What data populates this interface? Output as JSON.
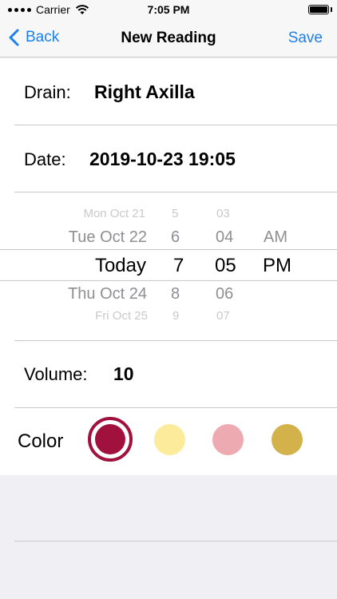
{
  "status_bar": {
    "carrier": "Carrier",
    "time": "7:05 PM",
    "wifi_icon": "wifi-icon",
    "battery_icon": "battery-icon"
  },
  "nav": {
    "back_label": "Back",
    "title": "New Reading",
    "save_label": "Save",
    "back_icon": "chevron-left-icon"
  },
  "form": {
    "drain": {
      "label": "Drain:",
      "value": "Right Axilla"
    },
    "date": {
      "label": "Date:",
      "value": "2019-10-23 19:05"
    },
    "volume": {
      "label": "Volume:",
      "value": "10"
    },
    "color": {
      "label": "Color",
      "swatches": [
        "#a0113e",
        "#fbeb9a",
        "#eeaab1",
        "#d3b24c"
      ],
      "selected_index": 0
    }
  },
  "picker": {
    "days": [
      "Mon Oct 21",
      "Tue Oct 22",
      "Today",
      "Thu Oct 24",
      "Fri Oct 25"
    ],
    "hours": [
      "5",
      "6",
      "7",
      "8",
      "9"
    ],
    "minutes": [
      "03",
      "04",
      "05",
      "06",
      "07"
    ],
    "ampm": [
      "AM",
      "PM"
    ]
  },
  "colors": {
    "accent": "#1a80f0",
    "separator": "#c8c7cc",
    "background": "#efeff4"
  }
}
